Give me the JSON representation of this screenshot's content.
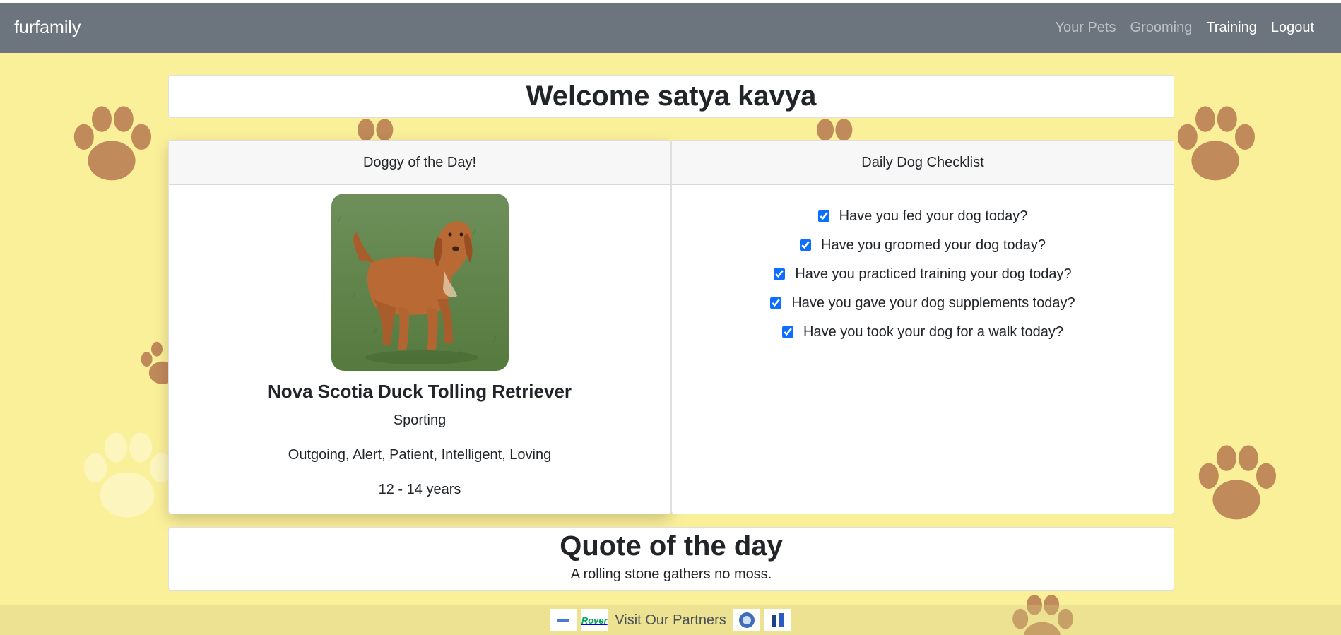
{
  "navbar": {
    "brand": "furfamily",
    "links": [
      {
        "label": "Your Pets"
      },
      {
        "label": "Grooming"
      },
      {
        "label": "Training"
      },
      {
        "label": "Logout"
      }
    ]
  },
  "welcome": {
    "title": "Welcome satya kavya"
  },
  "doggy_of_the_day": {
    "header": "Doggy of the Day!",
    "breed_name": "Nova Scotia Duck Tolling Retriever",
    "breed_group": "Sporting",
    "temperament": "Outgoing, Alert, Patient, Intelligent, Loving",
    "life_span": "12 - 14 years"
  },
  "checklist": {
    "header": "Daily Dog Checklist",
    "items": [
      {
        "label": "Have you fed your dog today?",
        "checked": true
      },
      {
        "label": "Have you groomed your dog today?",
        "checked": true
      },
      {
        "label": "Have you practiced training your dog today?",
        "checked": true
      },
      {
        "label": "Have you gave your dog supplements today?",
        "checked": true
      },
      {
        "label": "Have you took your dog for a walk today?",
        "checked": true
      }
    ]
  },
  "quote": {
    "title": "Quote of the day",
    "text": "A rolling stone gathers no moss."
  },
  "footer": {
    "partners_label": "Visit Our Partners",
    "logo_rover_text": "Rover"
  },
  "colors": {
    "navbar_bg": "#6c757d",
    "page_bg": "#fbf09a",
    "paw": "#c08a5a",
    "checkbox": "#0d6efd"
  }
}
